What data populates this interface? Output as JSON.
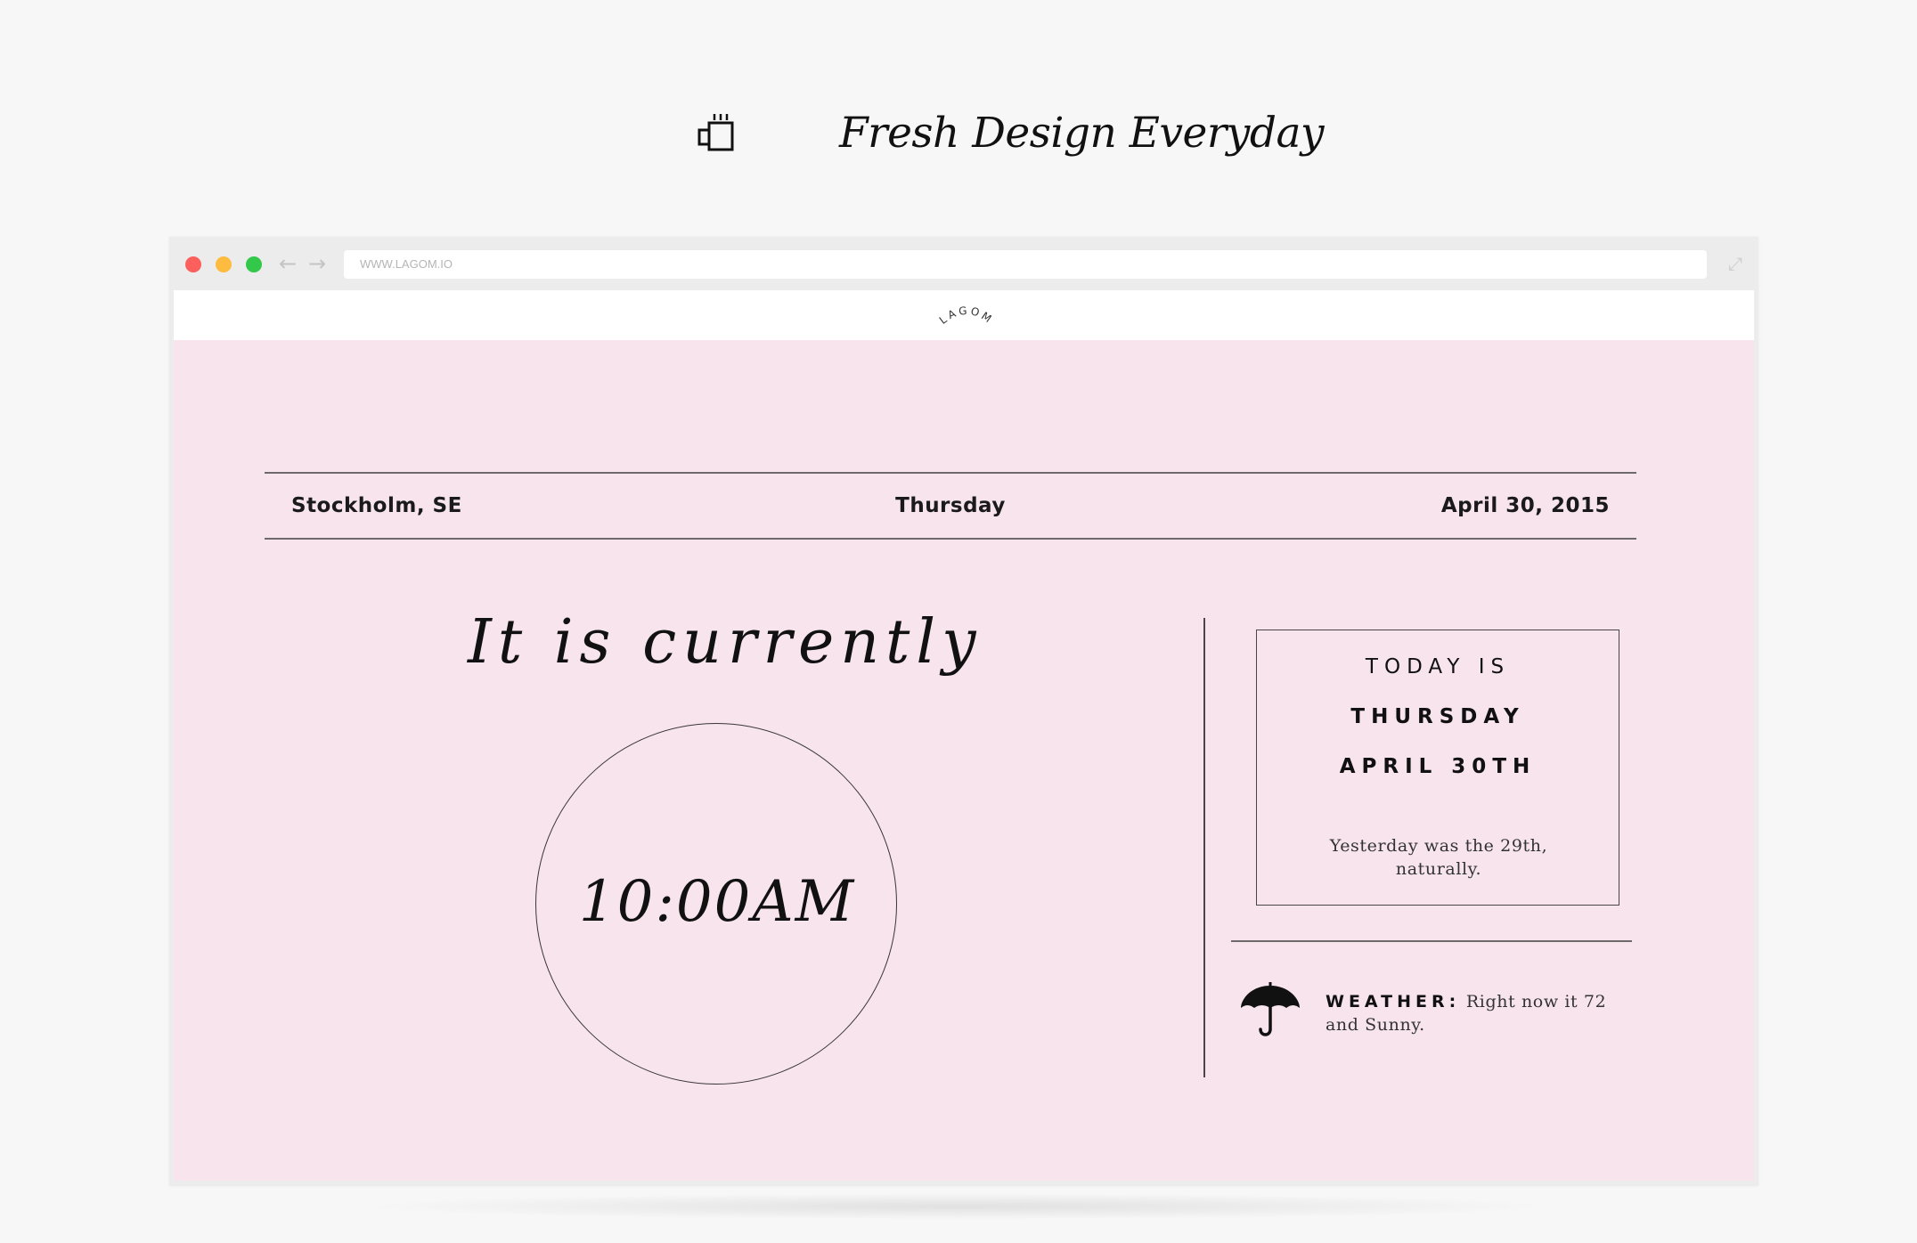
{
  "brand": {
    "tagline": "Fresh Design Everyday",
    "icon": "coffee-cup-icon"
  },
  "browser": {
    "url": "WWW.LAGOM.IO",
    "back_icon": "←",
    "forward_icon": "→",
    "expand_icon": "⤢"
  },
  "site": {
    "logo": "LAGOM"
  },
  "infobar": {
    "location": "Stockholm, SE",
    "weekday": "Thursday",
    "date": "April 30, 2015"
  },
  "clock": {
    "label": "It is currently",
    "time": "10:00AM"
  },
  "today": {
    "line1": "TODAY IS",
    "line2": "THURSDAY",
    "line3": "APRIL 30TH",
    "note": "Yesterday was the 29th, naturally."
  },
  "weather": {
    "icon": "umbrella-icon",
    "label": "WEATHER:",
    "text": "Right now it 72 and Sunny."
  },
  "colors": {
    "page_background": "#f7f7f7",
    "content_pink": "#f7e4ec",
    "close": "#fc605c",
    "minimize": "#fdbc40",
    "zoom": "#34c84a"
  }
}
